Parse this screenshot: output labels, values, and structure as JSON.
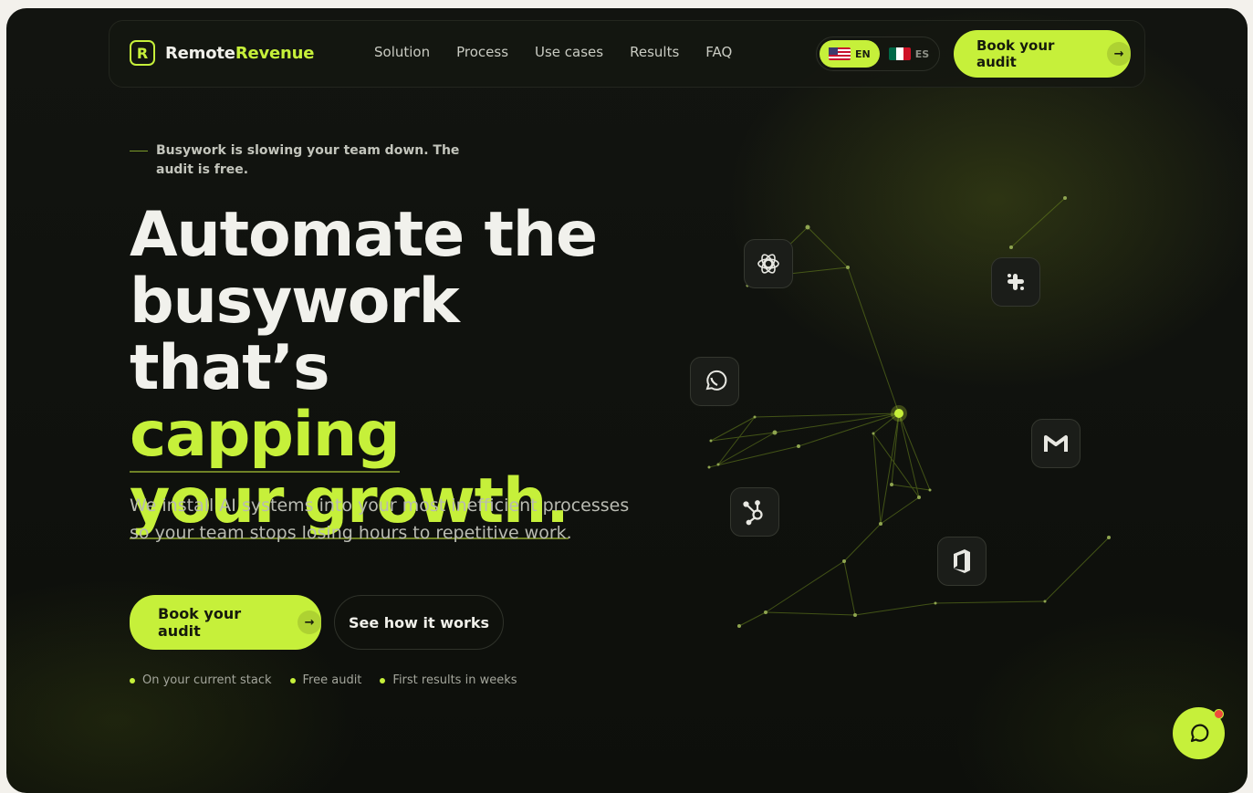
{
  "brand": {
    "name_part1": "Remote",
    "name_part2": "Revenue",
    "logo_letter": "R"
  },
  "nav": {
    "links": [
      "Solution",
      "Process",
      "Use cases",
      "Results",
      "FAQ"
    ],
    "languages": [
      {
        "code": "EN",
        "flag": "us-flag",
        "active": true
      },
      {
        "code": "ES",
        "flag": "mx-flag",
        "active": false
      }
    ],
    "cta_label": "Book your audit"
  },
  "hero": {
    "eyebrow": "Busywork is slowing your team down. The audit is free.",
    "headline_line1": "Automate the",
    "headline_line2": "busywork",
    "headline_line3_plain": "that’s ",
    "headline_highlight1": "capping",
    "headline_highlight2": "your growth.",
    "subtext": "We install AI systems into your most inefficient processes so your team stops losing hours to repetitive work.",
    "primary_cta": "Book your audit",
    "secondary_cta": "See how it works",
    "bullets": [
      "On your current stack",
      "Free audit",
      "First results in weeks"
    ]
  },
  "integrations": [
    "openai-icon",
    "slack-icon",
    "whatsapp-icon",
    "gmail-icon",
    "hubspot-icon",
    "office-icon"
  ],
  "colors": {
    "accent": "#c6f03a",
    "background": "#0f110d",
    "badge": "#ef4a3c"
  }
}
